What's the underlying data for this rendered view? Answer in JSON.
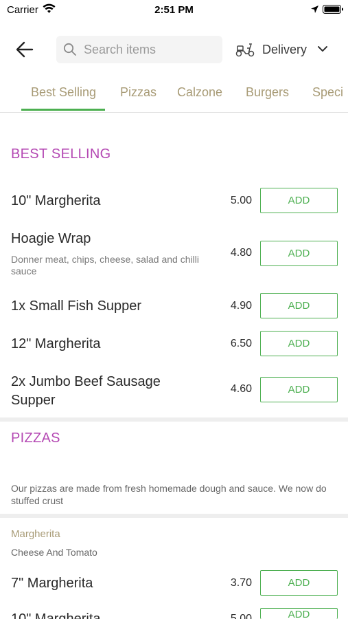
{
  "status_bar": {
    "carrier": "Carrier",
    "time": "2:51 PM"
  },
  "header": {
    "search_placeholder": "Search items",
    "delivery_label": "Delivery"
  },
  "tabs": [
    {
      "label": "Best Selling",
      "active": true
    },
    {
      "label": "Pizzas",
      "active": false
    },
    {
      "label": "Calzone",
      "active": false
    },
    {
      "label": "Burgers",
      "active": false
    },
    {
      "label": "Speci",
      "active": false
    }
  ],
  "sections": {
    "best_selling": {
      "title": "BEST SELLING",
      "items": [
        {
          "name": "10\" Margherita",
          "description": "",
          "price": "5.00",
          "button": "ADD"
        },
        {
          "name": "Hoagie Wrap",
          "description": "Donner meat, chips, cheese, salad and chilli sauce",
          "price": "4.80",
          "button": "ADD"
        },
        {
          "name": "1x Small Fish Supper",
          "description": "",
          "price": "4.90",
          "button": "ADD"
        },
        {
          "name": "12\" Margherita",
          "description": "",
          "price": "6.50",
          "button": "ADD"
        },
        {
          "name": "2x Jumbo Beef Sausage Supper",
          "description": "",
          "price": "4.60",
          "button": "ADD"
        }
      ]
    },
    "pizzas": {
      "title": "PIZZAS",
      "description": "Our pizzas are made from fresh homemade dough and sauce. We now do stuffed crust",
      "subsection": {
        "title": "Margherita",
        "description": "Cheese And Tomato",
        "items": [
          {
            "name": "7\" Margherita",
            "price": "3.70",
            "button": "ADD"
          },
          {
            "name": "10\" Margherita",
            "price": "5.00",
            "button": "ADD"
          }
        ]
      }
    }
  },
  "colors": {
    "accent_green": "#4caf50",
    "section_purple": "#b448b3",
    "tab_gold": "#a89b76"
  }
}
